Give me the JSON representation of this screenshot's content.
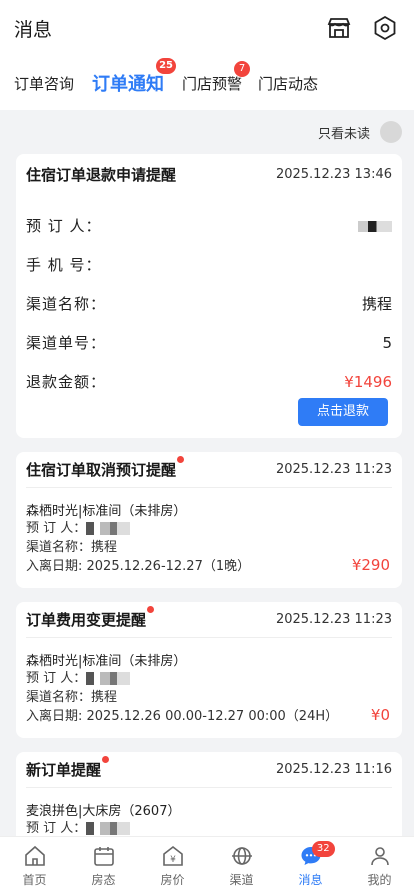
{
  "header": {
    "title": "消息"
  },
  "tabs": [
    {
      "label": "订单咨询",
      "badge": ""
    },
    {
      "label": "订单通知",
      "badge": "25"
    },
    {
      "label": "门店预警",
      "badge": "7"
    },
    {
      "label": "门店动态",
      "badge": ""
    }
  ],
  "filter": {
    "label": "只看未读"
  },
  "card1": {
    "title": "住宿订单退款申请提醒",
    "time": "2025.12.23 13:46",
    "rows": [
      {
        "key": "预 订 人：",
        "value": ""
      },
      {
        "key": "手 机 号：",
        "value": ""
      },
      {
        "key": "渠道名称：",
        "value": "携程"
      },
      {
        "key": "渠道单号：",
        "value": "5"
      },
      {
        "key": "退款金额：",
        "value": "¥1496"
      }
    ],
    "button": "点击退款"
  },
  "card2": {
    "title": "住宿订单取消预订提醒",
    "time": "2025.12.23 11:23",
    "room": "森栖时光|标准间（未排房）",
    "booker_label": "预 订 人：",
    "channel": "渠道名称：携程",
    "dates": "入离日期: 2025.12.26-12.27（1晚）",
    "price": "¥290"
  },
  "card3": {
    "title": "订单费用变更提醒",
    "time": "2025.12.23 11:23",
    "room": "森栖时光|标准间（未排房）",
    "booker_label": "预 订 人：",
    "channel": "渠道名称：携程",
    "dates": "入离日期: 2025.12.26 00.00-12.27 00:00（24H）",
    "price": "¥0"
  },
  "card4": {
    "title": "新订单提醒",
    "time": "2025.12.23 11:16",
    "room": "麦浪拼色|大床房（2607）",
    "booker_label": "预 订 人："
  },
  "nav": [
    {
      "label": "首页",
      "icon": "home-icon"
    },
    {
      "label": "房态",
      "icon": "calendar-icon"
    },
    {
      "label": "房价",
      "icon": "price-icon"
    },
    {
      "label": "渠道",
      "icon": "channel-icon"
    },
    {
      "label": "消息",
      "icon": "message-icon",
      "badge": "32"
    },
    {
      "label": "我的",
      "icon": "profile-icon"
    }
  ],
  "colors": {
    "accent": "#2f7cf6",
    "badge": "#f2443c"
  }
}
